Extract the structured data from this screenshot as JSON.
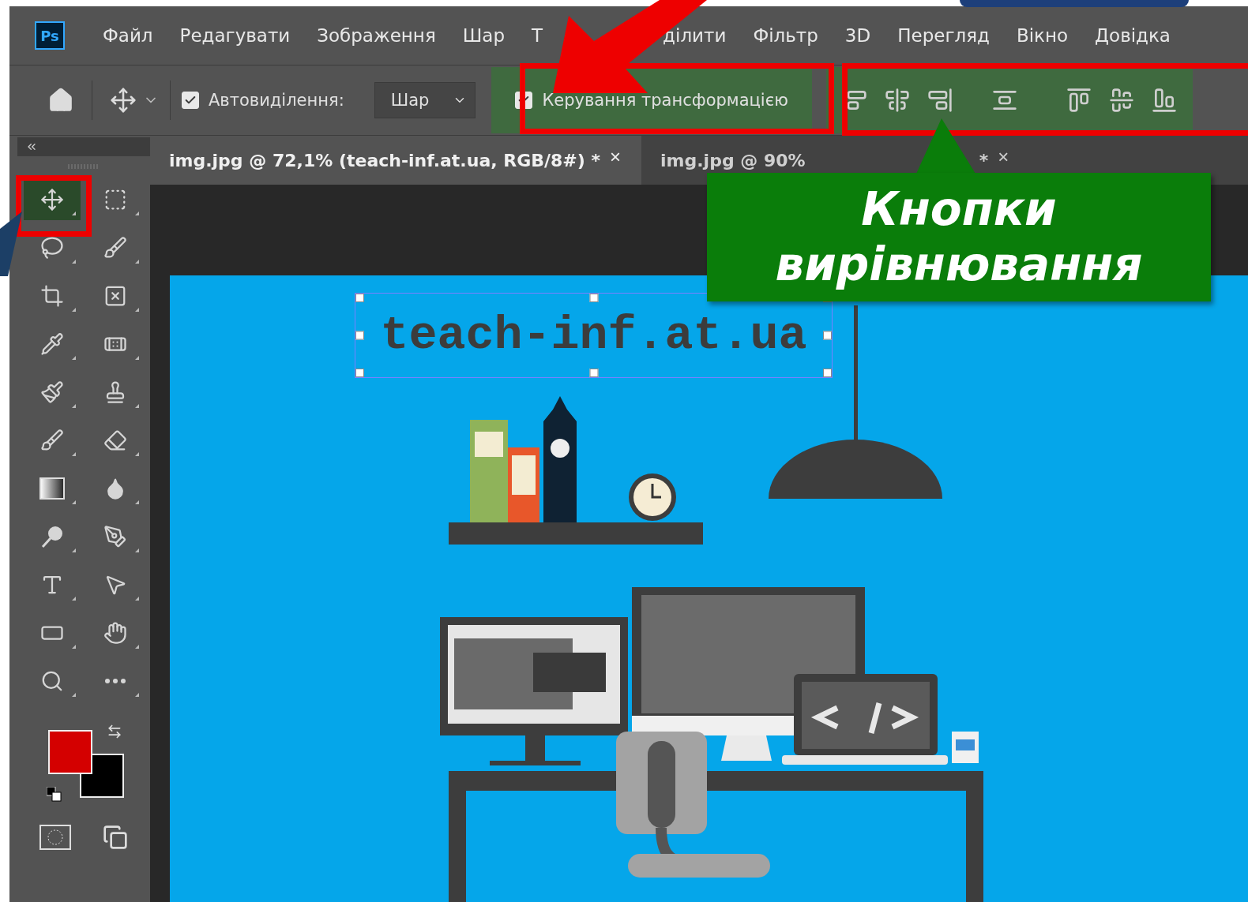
{
  "app": {
    "logo": "Ps"
  },
  "menu": [
    {
      "label": "Файл"
    },
    {
      "label": "Редагувати"
    },
    {
      "label": "Зображення"
    },
    {
      "label": "Шар"
    },
    {
      "label": "Т"
    },
    {
      "label": "ділити"
    },
    {
      "label": "Фільтр"
    },
    {
      "label": "3D"
    },
    {
      "label": "Перегляд"
    },
    {
      "label": "Вікно"
    },
    {
      "label": "Довідка"
    }
  ],
  "options_bar": {
    "auto_select": {
      "label": "Автовиділення:",
      "checked": true
    },
    "target": {
      "value": "Шар"
    },
    "transform_controls": {
      "label": "Керування трансформацією",
      "checked": true
    }
  },
  "tabs": [
    {
      "label": "img.jpg @ 72,1% (teach-inf.at.ua, RGB/8#) *",
      "close": "×",
      "selected": true
    },
    {
      "label": "img.jpg @ 90%",
      "suffix": "*",
      "close": "×",
      "selected": false
    }
  ],
  "tools": [
    {
      "kind": "move",
      "selected": true
    },
    {
      "kind": "marquee",
      "selected": false
    },
    {
      "kind": "lasso",
      "selected": false
    },
    {
      "kind": "quick-select",
      "selected": false
    },
    {
      "kind": "crop",
      "selected": false
    },
    {
      "kind": "frame",
      "selected": false
    },
    {
      "kind": "eyedropper",
      "selected": false
    },
    {
      "kind": "healing",
      "selected": false
    },
    {
      "kind": "brush",
      "selected": false
    },
    {
      "kind": "stamp",
      "selected": false
    },
    {
      "kind": "history-brush",
      "selected": false
    },
    {
      "kind": "eraser",
      "selected": false
    },
    {
      "kind": "gradient",
      "selected": false
    },
    {
      "kind": "blur",
      "selected": false
    },
    {
      "kind": "dodge",
      "selected": false
    },
    {
      "kind": "pen",
      "selected": false
    },
    {
      "kind": "type",
      "selected": false
    },
    {
      "kind": "path-select",
      "selected": false
    },
    {
      "kind": "rectangle",
      "selected": false
    },
    {
      "kind": "hand",
      "selected": false
    },
    {
      "kind": "zoom",
      "selected": false
    },
    {
      "kind": "more",
      "selected": false
    }
  ],
  "canvas": {
    "text_layer": "teach-inf.at.ua"
  },
  "callout": {
    "text": "Кнопки вирівнювання"
  }
}
